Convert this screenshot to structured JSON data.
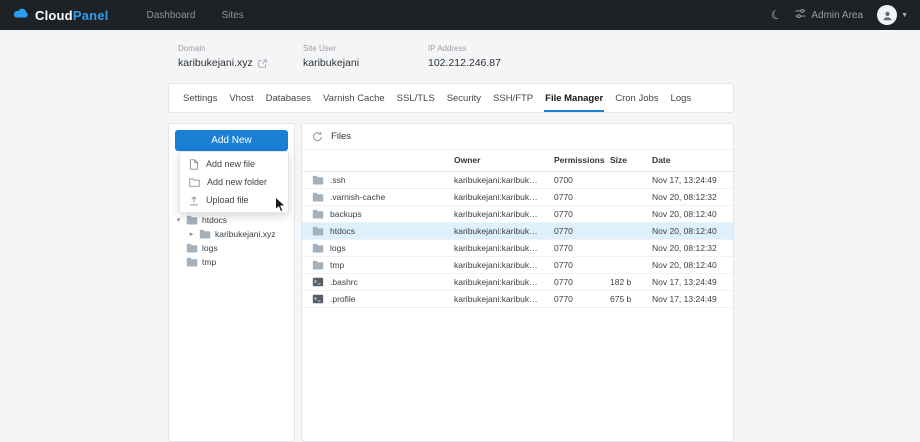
{
  "colors": {
    "accent": "#1b7fd4",
    "topbar_bg": "#1e2126",
    "brand_blue": "#2b9df0",
    "selected_row": "#def0fb"
  },
  "topbar": {
    "brand": {
      "cloud": "Cloud",
      "panel": "Panel"
    },
    "nav": [
      {
        "label": "Dashboard"
      },
      {
        "label": "Sites"
      }
    ],
    "right": {
      "admin_area": "Admin Area"
    }
  },
  "site_info": {
    "domain_label": "Domain",
    "domain_value": "karibukejani.xyz",
    "site_user_label": "Site User",
    "site_user_value": "karibukejani",
    "ip_label": "IP Address",
    "ip_value": "102.212.246.87"
  },
  "tabs": [
    {
      "label": "Settings",
      "active": false
    },
    {
      "label": "Vhost",
      "active": false
    },
    {
      "label": "Databases",
      "active": false
    },
    {
      "label": "Varnish Cache",
      "active": false
    },
    {
      "label": "SSL/TLS",
      "active": false
    },
    {
      "label": "Security",
      "active": false
    },
    {
      "label": "SSH/FTP",
      "active": false
    },
    {
      "label": "File Manager",
      "active": true
    },
    {
      "label": "Cron Jobs",
      "active": false
    },
    {
      "label": "Logs",
      "active": false
    }
  ],
  "sidebar": {
    "add_new_label": "Add New",
    "menu_items": [
      {
        "label": "Add new file",
        "icon": "file-plus-icon"
      },
      {
        "label": "Add new folder",
        "icon": "folder-plus-icon"
      },
      {
        "label": "Upload file",
        "icon": "upload-icon"
      }
    ],
    "tree": [
      {
        "label": "htdocs",
        "depth": 0,
        "arrow": "down"
      },
      {
        "label": "karibukejani.xyz",
        "depth": 1,
        "arrow": "right"
      },
      {
        "label": "logs",
        "depth": 0,
        "arrow": "none"
      },
      {
        "label": "tmp",
        "depth": 0,
        "arrow": "none"
      }
    ]
  },
  "files_panel": {
    "title": "Files",
    "columns": [
      "Owner",
      "Permissions",
      "Size",
      "Date"
    ],
    "rows": [
      {
        "name": ".ssh",
        "type": "folder",
        "owner": "karibukejani:karibukejani",
        "permissions": "0700",
        "size": "",
        "date": "Nov 17, 13:24:49",
        "selected": false
      },
      {
        "name": ".varnish-cache",
        "type": "folder",
        "owner": "karibukejani:karibukejani",
        "permissions": "0770",
        "size": "",
        "date": "Nov 20, 08:12:32",
        "selected": false
      },
      {
        "name": "backups",
        "type": "folder",
        "owner": "karibukejani:karibukejani",
        "permissions": "0770",
        "size": "",
        "date": "Nov 20, 08:12:40",
        "selected": false
      },
      {
        "name": "htdocs",
        "type": "folder",
        "owner": "karibukejani:karibukejani",
        "permissions": "0770",
        "size": "",
        "date": "Nov 20, 08:12:40",
        "selected": true
      },
      {
        "name": "logs",
        "type": "folder",
        "owner": "karibukejani:karibukejani",
        "permissions": "0770",
        "size": "",
        "date": "Nov 20, 08:12:32",
        "selected": false
      },
      {
        "name": "tmp",
        "type": "folder",
        "owner": "karibukejani:karibukejani",
        "permissions": "0770",
        "size": "",
        "date": "Nov 20, 08:12:40",
        "selected": false
      },
      {
        "name": ".bashrc",
        "type": "file",
        "owner": "karibukejani:karibukejani",
        "permissions": "0770",
        "size": "182 b",
        "date": "Nov 17, 13:24:49",
        "selected": false
      },
      {
        "name": ".profile",
        "type": "file",
        "owner": "karibukejani:karibukejani",
        "permissions": "0770",
        "size": "675 b",
        "date": "Nov 17, 13:24:49",
        "selected": false
      }
    ]
  }
}
